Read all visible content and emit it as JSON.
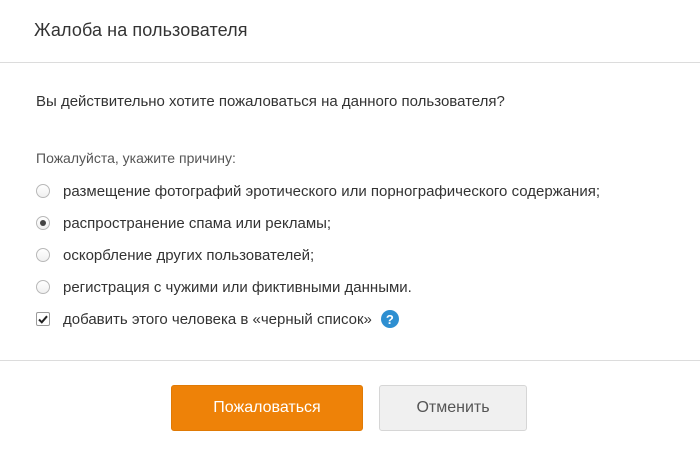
{
  "dialog": {
    "title": "Жалоба на пользователя",
    "question": "Вы действительно хотите пожаловаться на данного пользователя?",
    "reason_prompt": "Пожалуйста, укажите причину:",
    "options": [
      {
        "label": "размещение фотографий эротического или порнографического содержания;",
        "checked": false
      },
      {
        "label": "распространение спама или рекламы;",
        "checked": true
      },
      {
        "label": "оскорбление других пользователей;",
        "checked": false
      },
      {
        "label": "регистрация с чужими или фиктивными данными.",
        "checked": false
      }
    ],
    "blacklist_label": "добавить этого человека в «черный список»",
    "blacklist_checked": true,
    "help_icon": "?",
    "submit_label": "Пожаловаться",
    "cancel_label": "Отменить"
  },
  "colors": {
    "primary_button": "#ee8208",
    "help_icon": "#2e8fd1"
  }
}
